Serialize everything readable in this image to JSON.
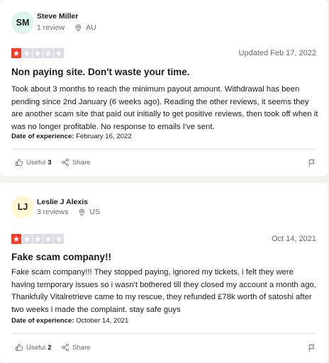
{
  "reviews": [
    {
      "avatar_initials": "SM",
      "avatar_color": "#dcf5ef",
      "author": "Steve Miller",
      "review_count": "1 review",
      "country": "AU",
      "rating": 1,
      "date": "Updated Feb 17, 2022",
      "title": "Non paying site. Don't waste your time.",
      "body": "Took about 3 months to reach the minimum payout amount. Withdrawal has been pending since 2nd January (6 weeks ago). Reading the other reviews, it seems they are another scam site that paid out initially to get positive reviews, then took off when it was no longer profitable. No response to emails I've sent.",
      "experience_label": "Date of experience:",
      "experience_date": "February 16, 2022",
      "useful_label": "Useful",
      "useful_count": "3",
      "share_label": "Share"
    },
    {
      "avatar_initials": "LJ",
      "avatar_color": "#fff8d2",
      "author": "Leslie J Alexis",
      "review_count": "3 reviews",
      "country": "US",
      "rating": 1,
      "date": "Oct 14, 2021",
      "title": "Fake scam company!!",
      "body": "Fake scam company!!! They stopped paying, ignored my tickets, i felt they were having temporary issues so i wasn't bothered till they closed my account a month ago, Thankfully Vitalretrieve came to my rescue, they refunded £78k worth of satoshi after two weeks i made the complaint. stay safe guys",
      "experience_label": "Date of experience:",
      "experience_date": "October 14, 2021",
      "useful_label": "Useful",
      "useful_count": "2",
      "share_label": "Share"
    }
  ],
  "colors": {
    "star_on": "#ff3722",
    "star_off": "#dcdce6",
    "background": "#f3f2ee"
  },
  "icons": {
    "location": "location-pin-icon",
    "useful": "thumbs-up-icon",
    "share": "share-icon",
    "flag": "flag-icon",
    "star": "star-icon"
  }
}
